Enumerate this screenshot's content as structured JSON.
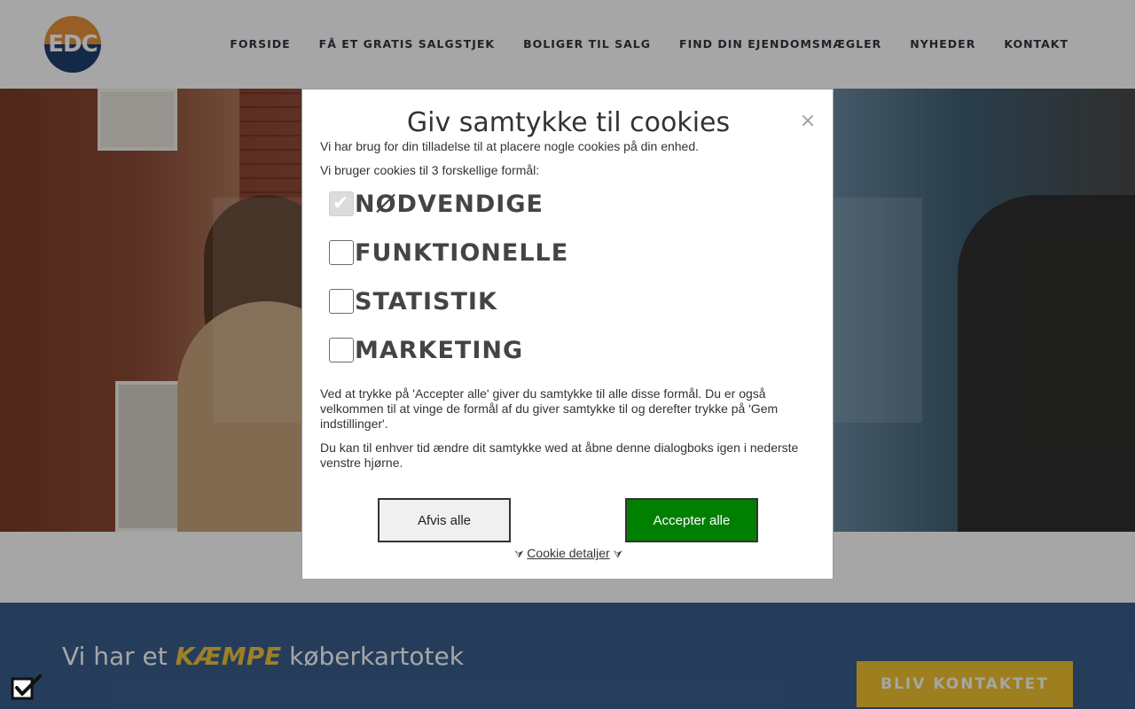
{
  "header": {
    "logo_text": "EDC",
    "nav": [
      {
        "label": "FORSIDE"
      },
      {
        "label": "FÅ ET GRATIS SALGSTJEK"
      },
      {
        "label": "BOLIGER TIL SALG"
      },
      {
        "label": "FIND DIN EJENDOMSMÆGLER"
      },
      {
        "label": "NYHEDER"
      },
      {
        "label": "KONTAKT"
      }
    ]
  },
  "banner": {
    "title_prefix": "Vi har et",
    "title_em": "KÆMPE",
    "title_suffix": "køberkartotek",
    "cta_label": "BLIV KONTAKTET"
  },
  "modal": {
    "title": "Giv samtykke til cookies",
    "close_label": "×",
    "intro": "Vi har brug for din tilladelse til at placere nogle cookies på din enhed.",
    "purposes_text": "Vi bruger cookies til 3 forskellige formål:",
    "options": [
      {
        "label": "NØDVENDIGE",
        "checked": true
      },
      {
        "label": "FUNKTIONELLE",
        "checked": false
      },
      {
        "label": "STATISTIK",
        "checked": false
      },
      {
        "label": "MARKETING",
        "checked": false
      }
    ],
    "info_1": "Ved at trykke på 'Accepter alle' giver du samtykke til alle disse formål. Du er også velkommen til at vinge de formål af du giver samtykke til og derefter trykke på 'Gem indstillinger'.",
    "info_2": "Du kan til enhver tid ændre dit samtykke wed at åbne denne dialogboks igen i nederste venstre hjørne.",
    "reject_label": "Afvis alle",
    "accept_label": "Accepter alle",
    "details_label": "Cookie detaljer",
    "details_arrow": "⮛"
  },
  "colors": {
    "accept": "#008000",
    "banner_bg": "#3a5f8c",
    "accent": "#f2c431"
  }
}
